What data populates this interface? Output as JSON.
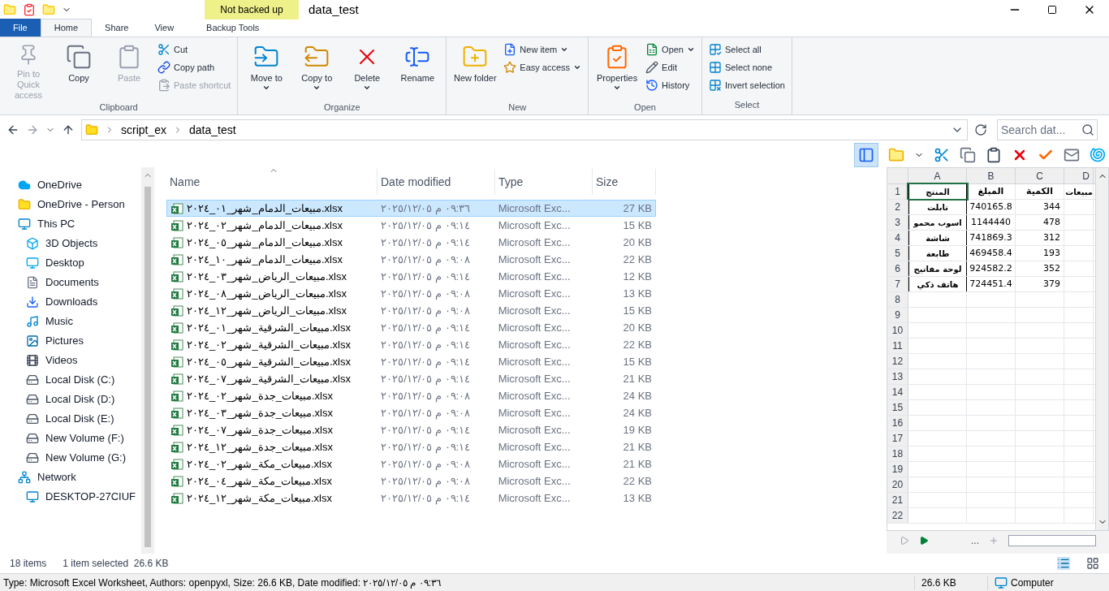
{
  "title_bar": {
    "context_label": "Not backed up",
    "title": "data_test"
  },
  "tabs": [
    {
      "label": "File",
      "kind": "file",
      "selected": false
    },
    {
      "label": "Home",
      "kind": "tab",
      "selected": true
    },
    {
      "label": "Share",
      "kind": "tab",
      "selected": false
    },
    {
      "label": "View",
      "kind": "tab",
      "selected": false
    },
    {
      "label": "Backup Tools",
      "kind": "context",
      "selected": false
    }
  ],
  "ribbon": [
    {
      "label": "Clipboard",
      "buttons": [
        {
          "label": "Pin to Quick access",
          "kind": "large",
          "disabled": true,
          "dropdown": false
        },
        {
          "label": "Copy",
          "kind": "large",
          "disabled": false,
          "dropdown": false
        },
        {
          "label": "Paste",
          "kind": "large",
          "disabled": true,
          "dropdown": false
        },
        {
          "label": "Cut",
          "kind": "small",
          "disabled": false,
          "dropdown": false
        },
        {
          "label": "Copy path",
          "kind": "small",
          "disabled": false,
          "dropdown": false
        },
        {
          "label": "Paste shortcut",
          "kind": "small",
          "disabled": true,
          "dropdown": false
        }
      ]
    },
    {
      "label": "Organize",
      "buttons": [
        {
          "label": "Move to",
          "kind": "large",
          "disabled": false,
          "dropdown": true
        },
        {
          "label": "Copy to",
          "kind": "large",
          "disabled": false,
          "dropdown": true
        },
        {
          "label": "Delete",
          "kind": "large",
          "disabled": false,
          "dropdown": true
        },
        {
          "label": "Rename",
          "kind": "large",
          "disabled": false,
          "dropdown": false
        }
      ]
    },
    {
      "label": "New",
      "buttons": [
        {
          "label": "New folder",
          "kind": "large",
          "disabled": false,
          "dropdown": false
        },
        {
          "label": "New item",
          "kind": "small",
          "disabled": false,
          "dropdown": true
        },
        {
          "label": "Easy access",
          "kind": "small",
          "disabled": false,
          "dropdown": true
        }
      ]
    },
    {
      "label": "Open",
      "buttons": [
        {
          "label": "Properties",
          "kind": "large",
          "disabled": false,
          "dropdown": true
        },
        {
          "label": "Open",
          "kind": "small",
          "disabled": false,
          "dropdown": true
        },
        {
          "label": "Edit",
          "kind": "small",
          "disabled": false,
          "dropdown": false
        },
        {
          "label": "History",
          "kind": "small",
          "disabled": false,
          "dropdown": false
        }
      ]
    },
    {
      "label": "Select",
      "buttons": [
        {
          "label": "Select all",
          "kind": "small",
          "disabled": false,
          "dropdown": false
        },
        {
          "label": "Select none",
          "kind": "small",
          "disabled": false,
          "dropdown": false
        },
        {
          "label": "Invert selection",
          "kind": "small",
          "disabled": false,
          "dropdown": false
        }
      ]
    }
  ],
  "address": {
    "path": [
      "script_ex",
      "data_test"
    ],
    "search_placeholder": "Search dat..."
  },
  "navigation": [
    {
      "label": "OneDrive",
      "kind": "cloud"
    },
    {
      "label": "OneDrive - Person",
      "kind": "folder"
    },
    {
      "label": "This PC",
      "kind": "pc",
      "children": [
        {
          "label": "3D Objects",
          "kind": "cube"
        },
        {
          "label": "Desktop",
          "kind": "desktop"
        },
        {
          "label": "Documents",
          "kind": "documents"
        },
        {
          "label": "Downloads",
          "kind": "downloads"
        },
        {
          "label": "Music",
          "kind": "music"
        },
        {
          "label": "Pictures",
          "kind": "pictures"
        },
        {
          "label": "Videos",
          "kind": "videos"
        },
        {
          "label": "Local Disk (C:)",
          "kind": "drive"
        },
        {
          "label": "Local Disk (D:)",
          "kind": "drive"
        },
        {
          "label": "Local Disk (E:)",
          "kind": "drive"
        },
        {
          "label": "New Volume (F:)",
          "kind": "drive"
        },
        {
          "label": "New Volume (G:)",
          "kind": "drive"
        }
      ]
    },
    {
      "label": "Network",
      "kind": "network",
      "children": [
        {
          "label": "DESKTOP-27CIUF",
          "kind": "pc"
        }
      ]
    }
  ],
  "columns": [
    "Name",
    "Date modified",
    "Type",
    "Size"
  ],
  "files": [
    {
      "name": "مبيعات_الدمام_شهر_٠١_٢٠٢٤.xlsx",
      "date": "٠٩:٣٦ م ٢٠٢٥/١٢/٠٥",
      "type": "Microsoft Exc...",
      "size": "27 KB",
      "selected": true
    },
    {
      "name": "مبيعات_الدمام_شهر_٠٢_٢٠٢٤.xlsx",
      "date": "٠٩:١٤ م ٢٠٢٥/١٢/٠٥",
      "type": "Microsoft Exc...",
      "size": "15 KB",
      "selected": false
    },
    {
      "name": "مبيعات_الدمام_شهر_٠٥_٢٠٢٤.xlsx",
      "date": "٠٩:١٤ م ٢٠٢٥/١٢/٠٥",
      "type": "Microsoft Exc...",
      "size": "20 KB",
      "selected": false
    },
    {
      "name": "مبيعات_الدمام_شهر_١٠_٢٠٢٤.xlsx",
      "date": "٠٩:٠٨ م ٢٠٢٥/١٢/٠٥",
      "type": "Microsoft Exc...",
      "size": "22 KB",
      "selected": false
    },
    {
      "name": "مبيعات_الرياض_شهر_٠٣_٢٠٢٤.xlsx",
      "date": "٠٩:١٤ م ٢٠٢٥/١٢/٠٥",
      "type": "Microsoft Exc...",
      "size": "12 KB",
      "selected": false
    },
    {
      "name": "مبيعات_الرياض_شهر_٠٨_٢٠٢٤.xlsx",
      "date": "٠٩:٠٨ م ٢٠٢٥/١٢/٠٥",
      "type": "Microsoft Exc...",
      "size": "13 KB",
      "selected": false
    },
    {
      "name": "مبيعات_الرياض_شهر_١٢_٢٠٢٤.xlsx",
      "date": "٠٩:٠٨ م ٢٠٢٥/١٢/٠٥",
      "type": "Microsoft Exc...",
      "size": "15 KB",
      "selected": false
    },
    {
      "name": "مبيعات_الشرقية_شهر_٠١_٢٠٢٤.xlsx",
      "date": "٠٩:١٤ م ٢٠٢٥/١٢/٠٥",
      "type": "Microsoft Exc...",
      "size": "20 KB",
      "selected": false
    },
    {
      "name": "مبيعات_الشرقية_شهر_٠٢_٢٠٢٤.xlsx",
      "date": "٠٩:١٤ م ٢٠٢٥/١٢/٠٥",
      "type": "Microsoft Exc...",
      "size": "22 KB",
      "selected": false
    },
    {
      "name": "مبيعات_الشرقية_شهر_٠٥_٢٠٢٤.xlsx",
      "date": "٠٩:١٤ م ٢٠٢٥/١٢/٠٥",
      "type": "Microsoft Exc...",
      "size": "15 KB",
      "selected": false
    },
    {
      "name": "مبيعات_الشرقية_شهر_٠٧_٢٠٢٤.xlsx",
      "date": "٠٩:١٤ م ٢٠٢٥/١٢/٠٥",
      "type": "Microsoft Exc...",
      "size": "21 KB",
      "selected": false
    },
    {
      "name": "مبيعات_جدة_شهر_٠٢_٢٠٢٤.xlsx",
      "date": "٠٩:٠٨ م ٢٠٢٥/١٢/٠٥",
      "type": "Microsoft Exc...",
      "size": "24 KB",
      "selected": false
    },
    {
      "name": "مبيعات_جدة_شهر_٠٣_٢٠٢٤.xlsx",
      "date": "٠٩:٠٨ م ٢٠٢٥/١٢/٠٥",
      "type": "Microsoft Exc...",
      "size": "24 KB",
      "selected": false
    },
    {
      "name": "مبيعات_جدة_شهر_٠٧_٢٠٢٤.xlsx",
      "date": "٠٩:١٤ م ٢٠٢٥/١٢/٠٥",
      "type": "Microsoft Exc...",
      "size": "19 KB",
      "selected": false
    },
    {
      "name": "مبيعات_جدة_شهر_١٢_٢٠٢٤.xlsx",
      "date": "٠٩:١٤ م ٢٠٢٥/١٢/٠٥",
      "type": "Microsoft Exc...",
      "size": "21 KB",
      "selected": false
    },
    {
      "name": "مبيعات_مكة_شهر_٠٢_٢٠٢٤.xlsx",
      "date": "٠٩:٠٨ م ٢٠٢٥/١٢/٠٥",
      "type": "Microsoft Exc...",
      "size": "21 KB",
      "selected": false
    },
    {
      "name": "مبيعات_مكة_شهر_٠٤_٢٠٢٤.xlsx",
      "date": "٠٩:٠٨ م ٢٠٢٥/١٢/٠٥",
      "type": "Microsoft Exc...",
      "size": "22 KB",
      "selected": false
    },
    {
      "name": "مبيعات_مكة_شهر_١٢_٢٠٢٤.xlsx",
      "date": "٠٩:١٤ م ٢٠٢٥/١٢/٠٥",
      "type": "Microsoft Exc...",
      "size": "13 KB",
      "selected": false
    }
  ],
  "preview": {
    "columns": [
      "A",
      "B",
      "C",
      "D"
    ],
    "bottom_label": "...",
    "rows": [
      {
        "number": "1",
        "cells": {
          "product": "المنتج",
          "amount": "المبلغ",
          "quantity": "الكمية",
          "column_4": "مبيعات"
        }
      },
      {
        "number": "2",
        "cells": {
          "product": "تابلت",
          "amount": "740165.8",
          "quantity": "344"
        }
      },
      {
        "number": "3",
        "cells": {
          "product": "اسوب محمو",
          "amount": "1144440",
          "quantity": "478"
        }
      },
      {
        "number": "4",
        "cells": {
          "product": "شاشة",
          "amount": "741869.3",
          "quantity": "312"
        }
      },
      {
        "number": "5",
        "cells": {
          "product": "طابعة",
          "amount": "469458.4",
          "quantity": "193"
        }
      },
      {
        "number": "6",
        "cells": {
          "product": "لوحة مفاتيح",
          "amount": "924582.2",
          "quantity": "352"
        }
      },
      {
        "number": "7",
        "cells": {
          "product": "هاتف ذكي",
          "amount": "724451.4",
          "quantity": "379"
        }
      },
      {
        "number": "8"
      },
      {
        "number": "9"
      },
      {
        "number": "10"
      },
      {
        "number": "11"
      },
      {
        "number": "12"
      },
      {
        "number": "13"
      },
      {
        "number": "14"
      },
      {
        "number": "15"
      },
      {
        "number": "16"
      },
      {
        "number": "17"
      },
      {
        "number": "18"
      },
      {
        "number": "19"
      },
      {
        "number": "20"
      },
      {
        "number": "21"
      },
      {
        "number": "22"
      }
    ]
  },
  "status_bar": {
    "item_count": "18 items",
    "selection": "1 item selected  26.6 KB"
  },
  "details_bar": {
    "text": "Type: Microsoft Excel Worksheet, Authors: openpyxl, Size: 26.6 KB, Date modified: ٠٩:٣٦ م ٢٠٢٥/١٢/٠٥",
    "size": "26.6 KB",
    "location": "Computer"
  }
}
